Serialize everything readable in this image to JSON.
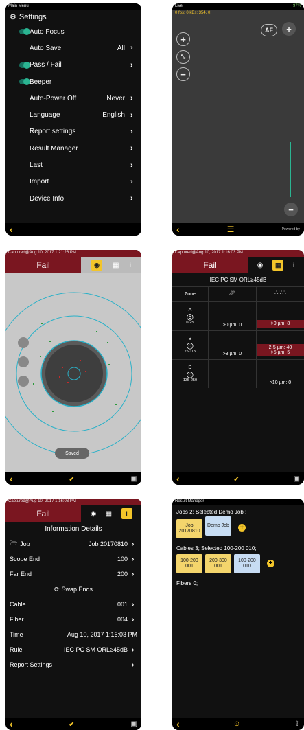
{
  "settings": {
    "bar": "Main Menu",
    "title": "Settings",
    "rows": [
      {
        "label": "Auto Focus",
        "value": "",
        "toggle": true,
        "arrow": false
      },
      {
        "label": "Auto Save",
        "value": "All",
        "toggle": false,
        "arrow": true
      },
      {
        "label": "Pass / Fail",
        "value": "",
        "toggle": true,
        "arrow": true
      },
      {
        "label": "Beeper",
        "value": "",
        "toggle": true,
        "arrow": false
      },
      {
        "label": "Auto-Power Off",
        "value": "Never",
        "toggle": false,
        "arrow": true
      },
      {
        "label": "Language",
        "value": "English",
        "toggle": false,
        "arrow": true
      },
      {
        "label": "Report settings",
        "value": "",
        "toggle": false,
        "arrow": true
      },
      {
        "label": "Result Manager",
        "value": "",
        "toggle": false,
        "arrow": true
      },
      {
        "label": "Last",
        "value": "",
        "toggle": false,
        "arrow": true
      },
      {
        "label": "Import",
        "value": "",
        "toggle": false,
        "arrow": true
      },
      {
        "label": "Device Info",
        "value": "",
        "toggle": false,
        "arrow": true
      }
    ]
  },
  "live": {
    "bar_left": "Live",
    "bar_right": "97%",
    "stats": "0 fps; 0 kBs; 354, 0;",
    "af_label": "AF",
    "powered": "Powered by"
  },
  "captured1": {
    "bar": "Captured@Aug 10, 2017 1:21:26 PM",
    "fail": "Fail",
    "saved": "Saved"
  },
  "captured2": {
    "bar": "Captured@Aug 10, 2017 1:16:03 PM",
    "fail": "Fail",
    "rule": "IEC PC SM ORL≥45dB",
    "zone_header": "Zone",
    "zones": [
      {
        "letter": "A",
        "range": "0-25",
        "scratch": ">0 µm: 0",
        "defect": ">0 µm: 8",
        "defect_red": true
      },
      {
        "letter": "B",
        "range": "25-115",
        "scratch": ">3 µm: 0",
        "defect": "2-5 µm: 40\n>5 µm: 5",
        "defect_red": true
      },
      {
        "letter": "D",
        "range": "135-250",
        "scratch": "",
        "defect": ">10 µm: 0",
        "defect_red": false
      }
    ]
  },
  "info": {
    "bar": "Captured@Aug 10, 2017 1:16:03 PM",
    "fail": "Fail",
    "title": "Information Details",
    "job_label": "Job",
    "job_value": "Job 20170810",
    "scope_label": "Scope End",
    "scope_value": "100",
    "far_label": "Far End",
    "far_value": "200",
    "swap": "Swap Ends",
    "cable_label": "Cable",
    "cable_value": "001",
    "fiber_label": "Fiber",
    "fiber_value": "004",
    "time_label": "Time",
    "time_value": "Aug 10, 2017 1:16:03 PM",
    "rule_label": "Rule",
    "rule_value": "IEC PC SM ORL≥45dB",
    "report_label": "Report Settings"
  },
  "result_manager": {
    "bar": "Result Manager",
    "jobs_text": "Jobs 2; Selected Demo Job ;",
    "jobs": [
      {
        "label": "Job 20170810",
        "color": "yellow"
      },
      {
        "label": "Demo Job",
        "color": "blue"
      }
    ],
    "cables_text": "Cables 3; Selected 100-200 010;",
    "cables": [
      {
        "label": "100-200 001",
        "color": "yellow"
      },
      {
        "label": "200-300 001",
        "color": "yellow"
      },
      {
        "label": "100-200 010",
        "color": "blue"
      }
    ],
    "fibers_text": "Fibers 0;"
  }
}
